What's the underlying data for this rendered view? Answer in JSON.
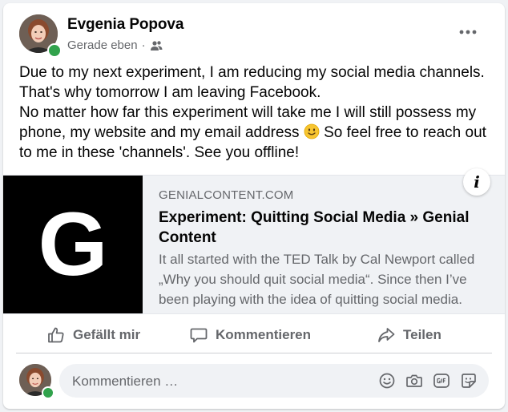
{
  "post": {
    "author": "Evgenia Popova",
    "timestamp": "Gerade eben",
    "separator": "·",
    "audience_icon": "friends-icon",
    "text_lines": [
      "Due to my next experiment, I am reducing my social media channels. That's why tomorrow I am leaving Facebook.",
      "No matter how far this experiment will take me I will still possess my phone, my website and my email address",
      "So feel free to reach out to me in these 'channels'. See you offline!"
    ],
    "inline_emoji": "slightly-smiling-face-emoji"
  },
  "link_preview": {
    "thumbnail_letter": "G",
    "domain": "GENIALCONTENT.COM",
    "title": "Experiment: Quitting Social Media » Genial Content",
    "description": "It all started with the TED Talk by Cal Newport called „Why you should quit social media“. Since then I’ve been playing with the idea of quitting social media.",
    "info_label": "i"
  },
  "actions": {
    "like_label": "Gefällt mir",
    "comment_label": "Kommentieren",
    "share_label": "Teilen"
  },
  "comment_composer": {
    "placeholder": "Kommentieren …",
    "icons": [
      "emoji-icon",
      "camera-icon",
      "gif-icon",
      "sticker-icon"
    ]
  },
  "colors": {
    "secondary_text": "#65676b",
    "online_green": "#31a24c",
    "background": "#f0f2f5"
  }
}
